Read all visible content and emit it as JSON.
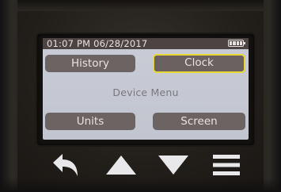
{
  "status_bar": {
    "datetime": "01:07 PM 06/28/2017",
    "battery_icon": "battery-full-icon"
  },
  "menu": {
    "title": "Device Menu",
    "buttons": {
      "history": "History",
      "clock": "Clock",
      "units": "Units",
      "screen": "Screen"
    },
    "selected": "Clock"
  },
  "hardware_keys": [
    {
      "icon": "back-arrow-icon"
    },
    {
      "icon": "up-arrow-icon"
    },
    {
      "icon": "down-arrow-icon"
    },
    {
      "icon": "hamburger-menu-icon"
    }
  ],
  "colors": {
    "screen_bg": "#c9ccd6",
    "button_bg": "#6c6462",
    "selection_outline": "#e8d836",
    "status_bar_bg": "#4b4442",
    "title_text": "#7b7680",
    "key_icon": "#e8e8ea"
  }
}
